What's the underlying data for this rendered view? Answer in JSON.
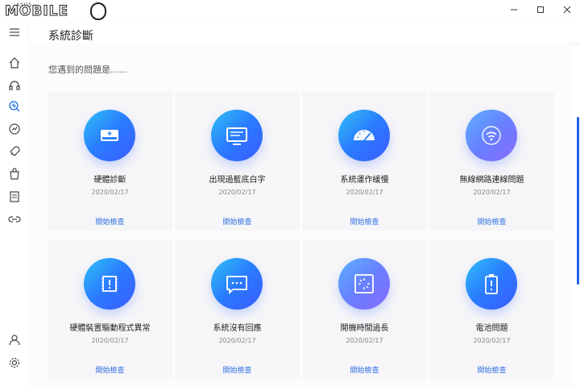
{
  "app": {
    "brand": "MOBILE",
    "brand_small": "ASUS",
    "window_controls": [
      "minimize",
      "maximize",
      "close"
    ]
  },
  "sidebar": {
    "items": [
      {
        "icon": "menu-icon"
      },
      {
        "icon": "home-icon"
      },
      {
        "icon": "headset-icon"
      },
      {
        "icon": "diagnosis-icon",
        "active": true
      },
      {
        "icon": "speed-icon"
      },
      {
        "icon": "rocket-icon"
      },
      {
        "icon": "bag-icon"
      },
      {
        "icon": "document-icon"
      },
      {
        "icon": "link-icon"
      },
      {
        "icon": "user-icon"
      },
      {
        "icon": "gear-icon"
      }
    ]
  },
  "header": {
    "title": "系統診斷"
  },
  "main": {
    "subtitle": "您遇到的問題是......",
    "action_label": "開始檢查",
    "cards": [
      {
        "label": "硬體診斷",
        "date": "2020/02/17",
        "action": "開始檢查",
        "icon": "hard-drive-icon"
      },
      {
        "label": "出現過藍底白字",
        "date": "2020/02/17",
        "action": "開始檢查",
        "icon": "monitor-icon"
      },
      {
        "label": "系統運作緩慢",
        "date": "2020/02/17",
        "action": "開始檢查",
        "icon": "speedometer-icon"
      },
      {
        "label": "無線網路連線問題",
        "date": "2020/02/17",
        "action": "開始檢查",
        "icon": "wifi-icon"
      },
      {
        "label": "硬體裝置驅動程式異常",
        "date": "2020/02/17",
        "action": "開始檢查",
        "icon": "chip-alert-icon"
      },
      {
        "label": "系統沒有回應",
        "date": "2020/02/17",
        "action": "開始檢查",
        "icon": "chat-screen-icon"
      },
      {
        "label": "開機時間過長",
        "date": "2020/02/17",
        "action": "開始檢查",
        "icon": "loading-screen-icon"
      },
      {
        "label": "電池問題",
        "date": "2020/02/17",
        "action": "開始檢查",
        "icon": "battery-icon"
      }
    ]
  },
  "colors": {
    "accent": "#2f6fe0",
    "icon_gradient_start": "#2fc1f5",
    "icon_gradient_end": "#3b5bff",
    "card_bg": "#f6f6f8",
    "scrollbar": "#2563eb"
  }
}
